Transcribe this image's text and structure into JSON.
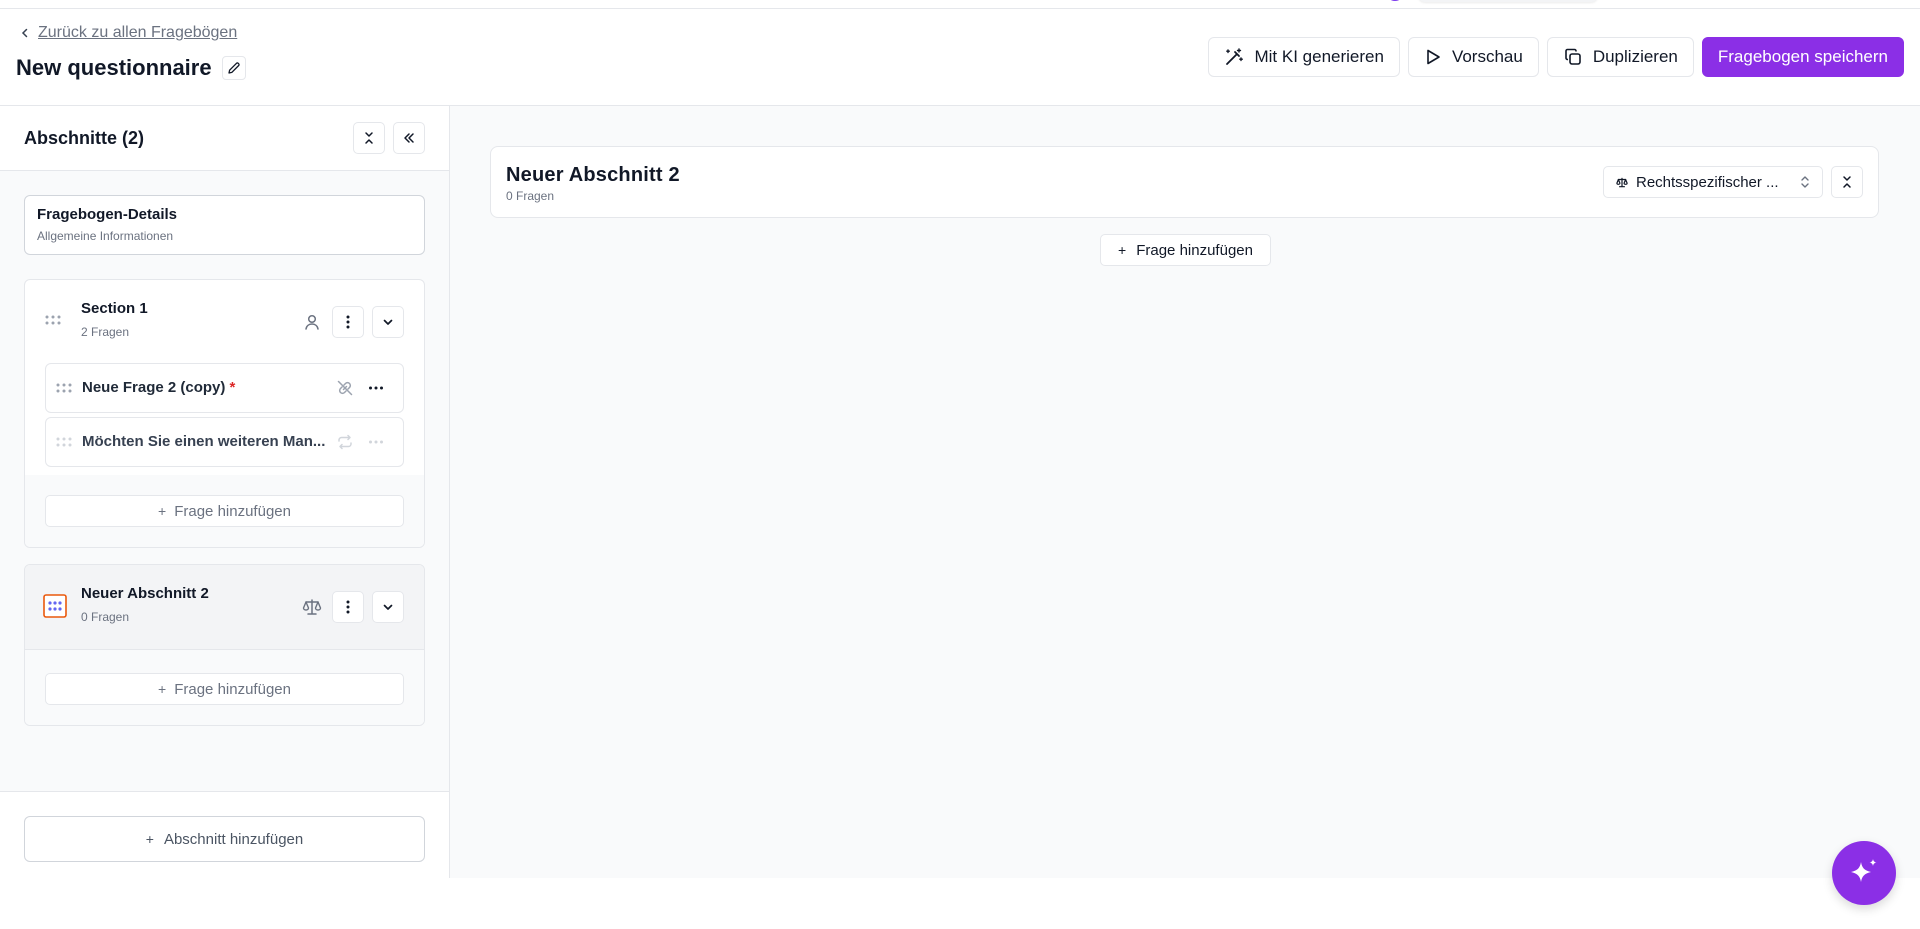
{
  "header": {
    "back_link": "Zurück zu allen Fragebögen",
    "title": "New questionnaire",
    "actions": {
      "ai_generate": "Mit KI generieren",
      "preview": "Vorschau",
      "duplicate": "Duplizieren",
      "save": "Fragebogen speichern"
    }
  },
  "sidebar": {
    "title": "Abschnitte (2)",
    "details": {
      "title": "Fragebogen-Details",
      "subtitle": "Allgemeine Informationen"
    },
    "sections": [
      {
        "title": "Section 1",
        "subtitle": "2 Fragen",
        "questions": [
          {
            "label": "Neue Frage 2 (copy)",
            "required": "*"
          },
          {
            "label": "Möchten Sie einen weiteren Man..."
          }
        ],
        "add_question": "Frage hinzufügen"
      },
      {
        "title": "Neuer Abschnitt 2",
        "subtitle": "0 Fragen",
        "add_question": "Frage hinzufügen"
      }
    ],
    "add_section": "Abschnitt hinzufügen"
  },
  "main": {
    "section_title": "Neuer Abschnitt 2",
    "section_subtitle": "0 Fragen",
    "select_value": "Rechtsspezifischer ...",
    "add_question": "Frage hinzufügen"
  },
  "colors": {
    "accent": "#8b2fe6",
    "required": "#dc2626",
    "drag_active": "#ea580c"
  }
}
